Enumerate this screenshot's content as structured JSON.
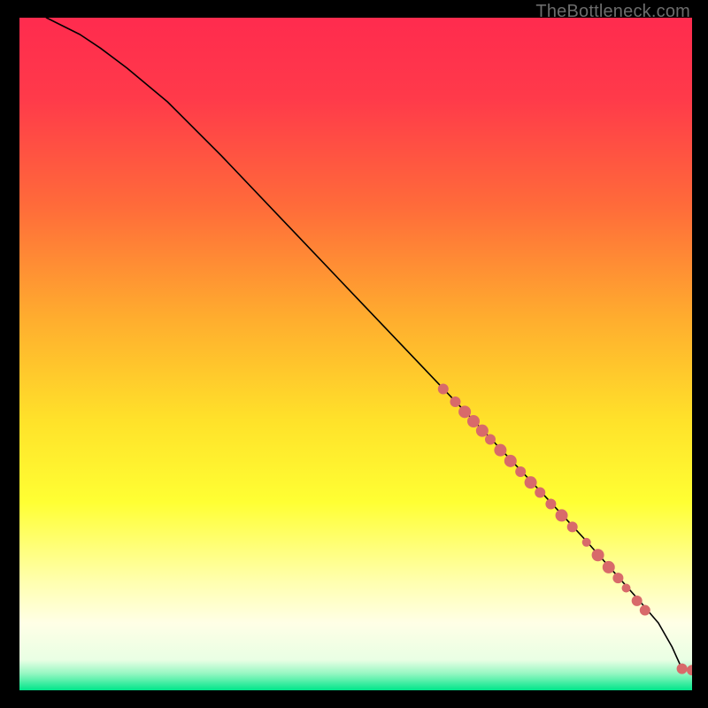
{
  "watermark": "TheBottleneck.com",
  "chart_data": {
    "type": "line",
    "title": "",
    "xlabel": "",
    "ylabel": "",
    "xlim": [
      0,
      100
    ],
    "ylim": [
      0,
      100
    ],
    "grid": false,
    "legend": false,
    "gradient_stops": [
      {
        "offset": 0.0,
        "color": "#ff2b4e"
      },
      {
        "offset": 0.12,
        "color": "#ff3a4a"
      },
      {
        "offset": 0.28,
        "color": "#ff6b3a"
      },
      {
        "offset": 0.45,
        "color": "#ffae2e"
      },
      {
        "offset": 0.6,
        "color": "#ffe22a"
      },
      {
        "offset": 0.72,
        "color": "#ffff33"
      },
      {
        "offset": 0.84,
        "color": "#ffffb0"
      },
      {
        "offset": 0.9,
        "color": "#ffffe6"
      },
      {
        "offset": 0.955,
        "color": "#e9ffe4"
      },
      {
        "offset": 0.975,
        "color": "#96f7c2"
      },
      {
        "offset": 1.0,
        "color": "#00e58a"
      }
    ],
    "series": [
      {
        "name": "curve",
        "x": [
          4,
          6,
          9,
          12,
          16,
          22,
          30,
          40,
          50,
          60,
          70,
          78,
          84,
          88,
          92,
          95,
          97,
          98.5,
          100
        ],
        "y": [
          100,
          99,
          97.5,
          95.5,
          92.5,
          87.5,
          79.5,
          69.0,
          58.5,
          48.0,
          37.5,
          29.0,
          22.5,
          18.0,
          13.5,
          10.0,
          6.5,
          3.2,
          3.0
        ]
      }
    ],
    "scatter": {
      "name": "points",
      "color": "#d86a6a",
      "points": [
        {
          "x": 63.0,
          "y": 44.8,
          "r": 6
        },
        {
          "x": 64.8,
          "y": 42.9,
          "r": 6
        },
        {
          "x": 66.2,
          "y": 41.4,
          "r": 7
        },
        {
          "x": 67.5,
          "y": 40.0,
          "r": 7
        },
        {
          "x": 68.8,
          "y": 38.6,
          "r": 7
        },
        {
          "x": 70.0,
          "y": 37.3,
          "r": 6
        },
        {
          "x": 71.5,
          "y": 35.7,
          "r": 7
        },
        {
          "x": 73.0,
          "y": 34.1,
          "r": 7
        },
        {
          "x": 74.5,
          "y": 32.5,
          "r": 6
        },
        {
          "x": 76.0,
          "y": 30.9,
          "r": 7
        },
        {
          "x": 77.4,
          "y": 29.4,
          "r": 6
        },
        {
          "x": 79.0,
          "y": 27.7,
          "r": 6
        },
        {
          "x": 80.6,
          "y": 26.0,
          "r": 7
        },
        {
          "x": 82.2,
          "y": 24.3,
          "r": 6
        },
        {
          "x": 84.3,
          "y": 22.0,
          "r": 5
        },
        {
          "x": 86.0,
          "y": 20.1,
          "r": 7
        },
        {
          "x": 87.6,
          "y": 18.3,
          "r": 7
        },
        {
          "x": 89.0,
          "y": 16.7,
          "r": 6
        },
        {
          "x": 90.2,
          "y": 15.2,
          "r": 5
        },
        {
          "x": 91.8,
          "y": 13.3,
          "r": 6
        },
        {
          "x": 93.0,
          "y": 11.9,
          "r": 6
        },
        {
          "x": 98.5,
          "y": 3.2,
          "r": 6
        },
        {
          "x": 100.0,
          "y": 3.0,
          "r": 6
        }
      ]
    }
  }
}
